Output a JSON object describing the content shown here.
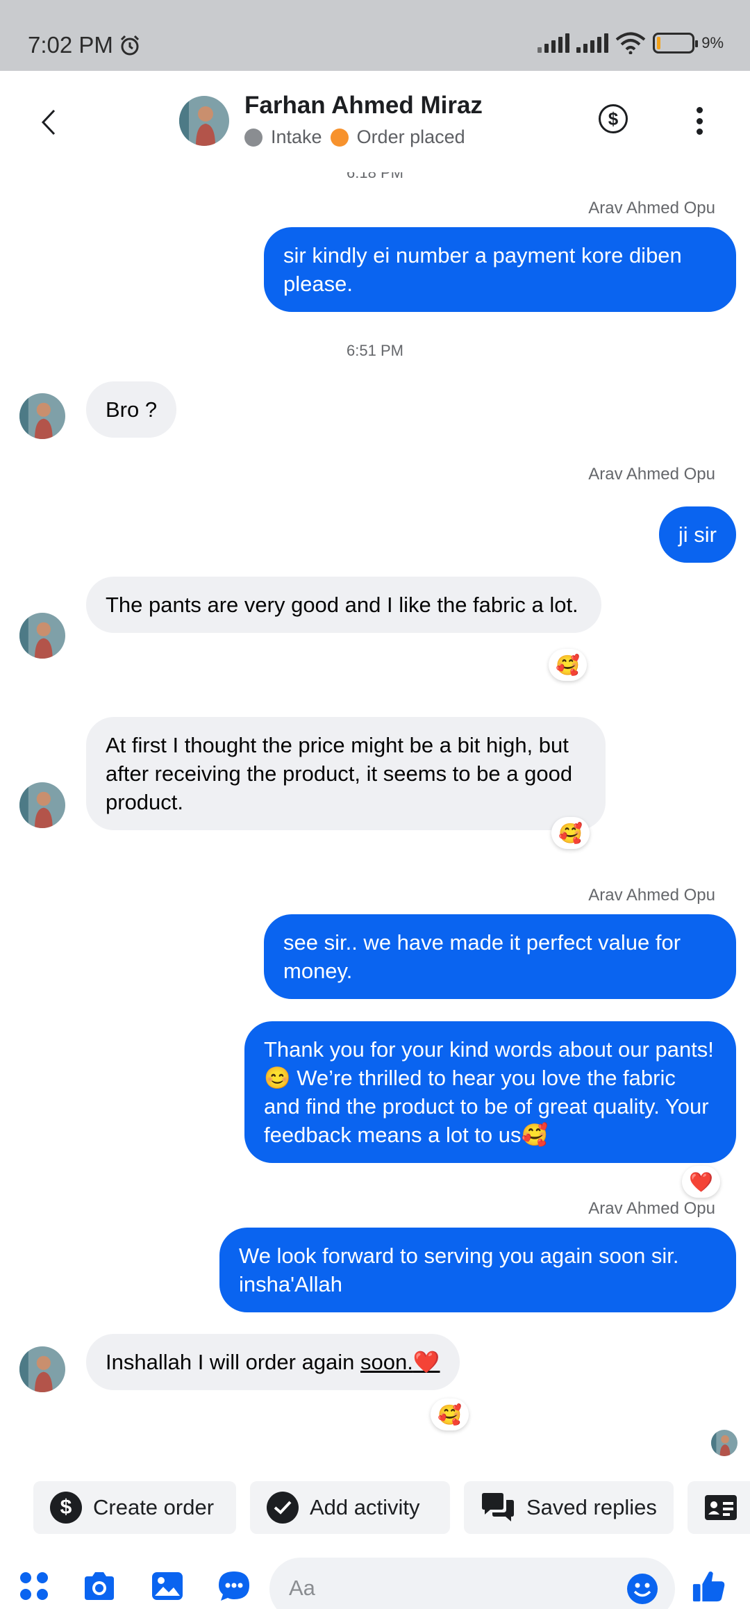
{
  "status_bar": {
    "time": "7:02 PM",
    "battery": "9%"
  },
  "header": {
    "contact_name": "Farhan Ahmed Miraz",
    "labels": [
      {
        "text": "Intake",
        "color": "#8a8d91"
      },
      {
        "text": "Order placed",
        "color": "#f7922d"
      }
    ],
    "dollar_symbol": "$"
  },
  "messages": {
    "partial_time": "6:18 PM",
    "m1_sender": "Arav Ahmed Opu",
    "m1_text": "sir kindly ei number a payment kore diben please.",
    "time_sep": "6:51 PM",
    "m2_text": "Bro ?",
    "m3_sender": "Arav Ahmed Opu",
    "m3_text": "ji sir",
    "m4_text": "The pants are very good and I like the fabric a lot.",
    "m4_reaction": "🥰",
    "m5_text": "At first I thought the price might be a bit high, but after receiving the product, it seems to be a good product.",
    "m5_reaction": "🥰",
    "m6_sender": "Arav Ahmed Opu",
    "m6_text": "see sir.. we have made it perfect value for money.",
    "m7_text": "Thank you for your kind words about our pants! 😊 We’re thrilled to hear you love the fabric and find the product to be of great quality. Your feedback means a lot to us🥰",
    "m7_reaction": "❤️",
    "m8_sender": "Arav Ahmed Opu",
    "m8_text": "We look forward to serving you again soon sir. insha'Allah",
    "m9_text_a": "Inshallah I will order again ",
    "m9_text_b": "soon.",
    "m9_heart": "❤️",
    "m9_reaction": "🥰"
  },
  "quick_actions": {
    "create_order": "Create order",
    "create_order_symbol": "$",
    "add_activity": "Add activity",
    "saved_replies": "Saved replies"
  },
  "composer": {
    "placeholder": "Aa"
  },
  "colors": {
    "accent": "#0a64f0",
    "incoming_bubble": "#eff0f3"
  }
}
